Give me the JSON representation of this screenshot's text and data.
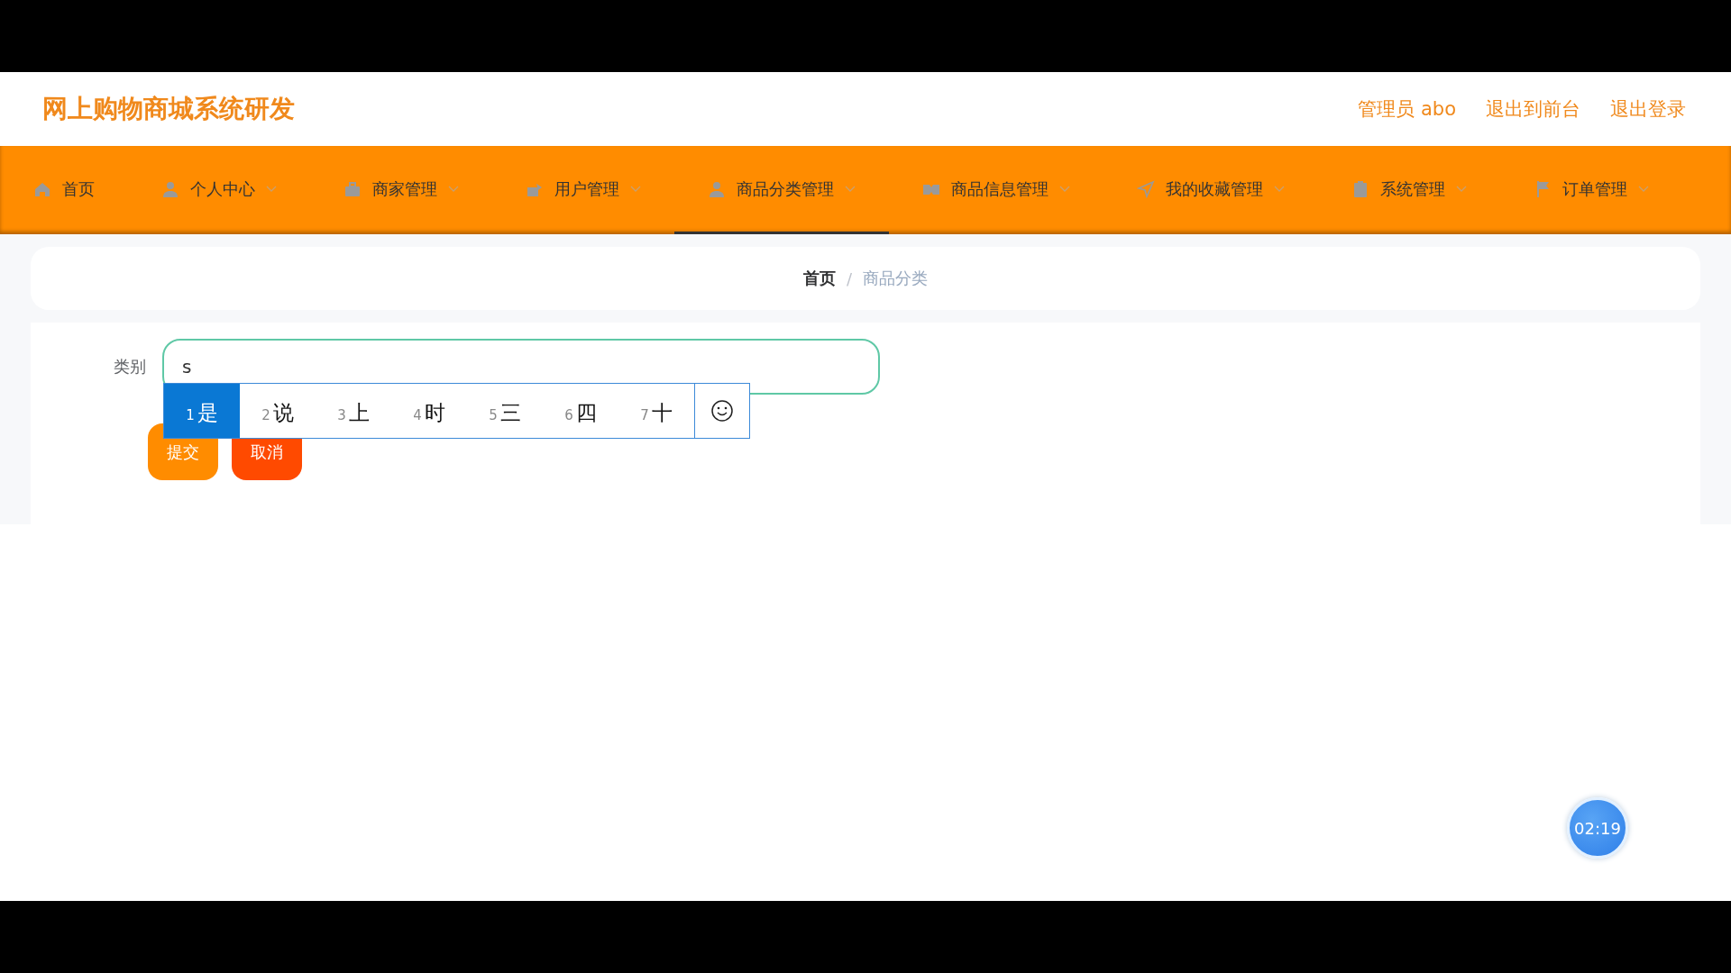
{
  "header": {
    "title": "网上购物商城系统研发",
    "links": [
      {
        "text": "管理员 abo"
      },
      {
        "text": "退出到前台"
      },
      {
        "text": "退出登录"
      }
    ]
  },
  "nav": [
    {
      "label": "首页",
      "selected": false,
      "has_dropdown": false
    },
    {
      "label": "个人中心",
      "selected": false,
      "has_dropdown": true
    },
    {
      "label": "商家管理",
      "selected": false,
      "has_dropdown": true
    },
    {
      "label": "用户管理",
      "selected": false,
      "has_dropdown": true
    },
    {
      "label": "商品分类管理",
      "selected": true,
      "has_dropdown": true
    },
    {
      "label": "商品信息管理",
      "selected": false,
      "has_dropdown": true
    },
    {
      "label": "我的收藏管理",
      "selected": false,
      "has_dropdown": true
    },
    {
      "label": "系统管理",
      "selected": false,
      "has_dropdown": true
    },
    {
      "label": "订单管理",
      "selected": false,
      "has_dropdown": true
    }
  ],
  "breadcrumb": [
    {
      "text": "首页",
      "current": false
    },
    {
      "text": "商品分类",
      "current": true
    }
  ],
  "breadcrumb_separator": "/",
  "form": {
    "field": {
      "label": "类别",
      "value": "s"
    },
    "ime_candidates": [
      {
        "number": "1",
        "text": "是",
        "selected": true
      },
      {
        "number": "2",
        "text": "说",
        "selected": false
      },
      {
        "number": "3",
        "text": "上",
        "selected": false
      },
      {
        "number": "4",
        "text": "时",
        "selected": false
      },
      {
        "number": "5",
        "text": "三",
        "selected": false
      },
      {
        "number": "6",
        "text": "四",
        "selected": false
      },
      {
        "number": "7",
        "text": "十",
        "selected": false
      }
    ],
    "buttons": [
      {
        "label": "提交",
        "kind": "primary"
      },
      {
        "label": "取消",
        "kind": "danger"
      }
    ]
  },
  "timer": "02:19"
}
